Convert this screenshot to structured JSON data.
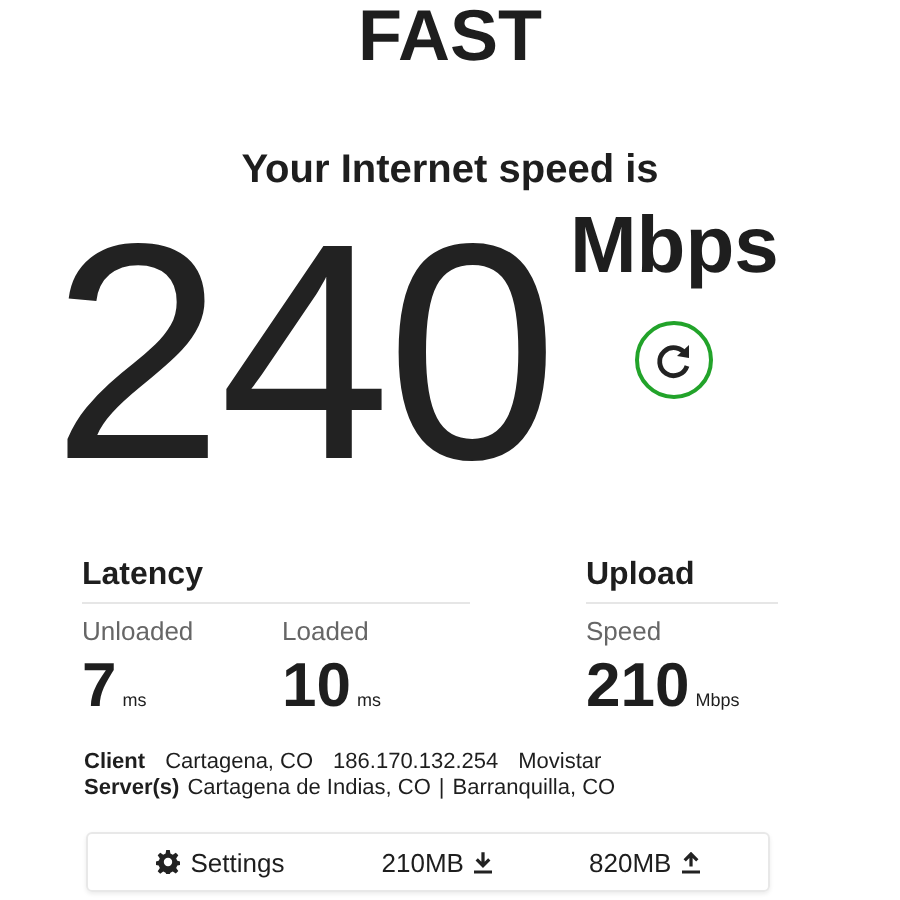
{
  "logo": "FAST",
  "heading": "Your Internet speed is",
  "speed": {
    "value": "240",
    "unit": "Mbps"
  },
  "groups": [
    {
      "title": "Latency",
      "metrics": [
        {
          "label": "Unloaded",
          "value": "7",
          "unit": "ms"
        },
        {
          "label": "Loaded",
          "value": "10",
          "unit": "ms"
        }
      ]
    },
    {
      "title": "Upload",
      "metrics": [
        {
          "label": "Speed",
          "value": "210",
          "unit": "Mbps"
        }
      ]
    }
  ],
  "client": {
    "label": "Client",
    "parts": [
      "Cartagena, CO",
      "186.170.132.254",
      "Movistar"
    ]
  },
  "servers": {
    "label": "Server(s)",
    "parts": [
      "Cartagena de Indias, CO",
      "|",
      "Barranquilla, CO"
    ]
  },
  "footer": [
    {
      "kind": "settings",
      "label": "Settings"
    },
    {
      "kind": "download",
      "label": "210MB"
    },
    {
      "kind": "upload",
      "label": "820MB"
    }
  ]
}
